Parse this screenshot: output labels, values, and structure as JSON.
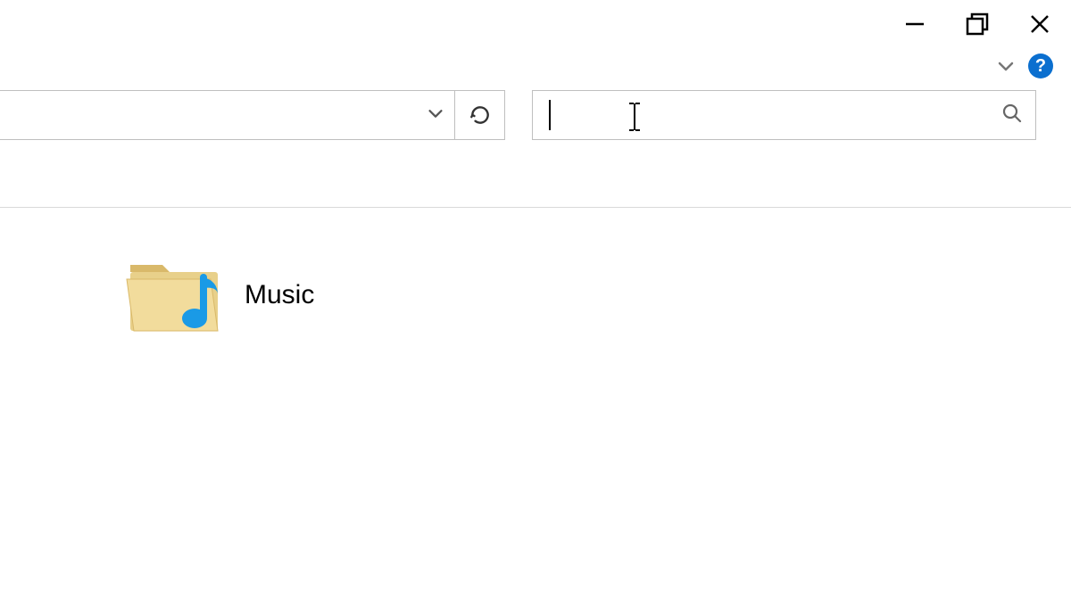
{
  "window": {
    "minimize_tooltip": "Minimize",
    "maximize_tooltip": "Restore Down",
    "close_tooltip": "Close"
  },
  "ribbon": {
    "collapse_tooltip": "Minimize the Ribbon",
    "help_label": "?"
  },
  "nav": {
    "address_value": "",
    "refresh_tooltip": "Refresh",
    "search_value": "",
    "search_placeholder": ""
  },
  "content": {
    "items": [
      {
        "label": "Music",
        "kind": "music-folder"
      }
    ]
  }
}
